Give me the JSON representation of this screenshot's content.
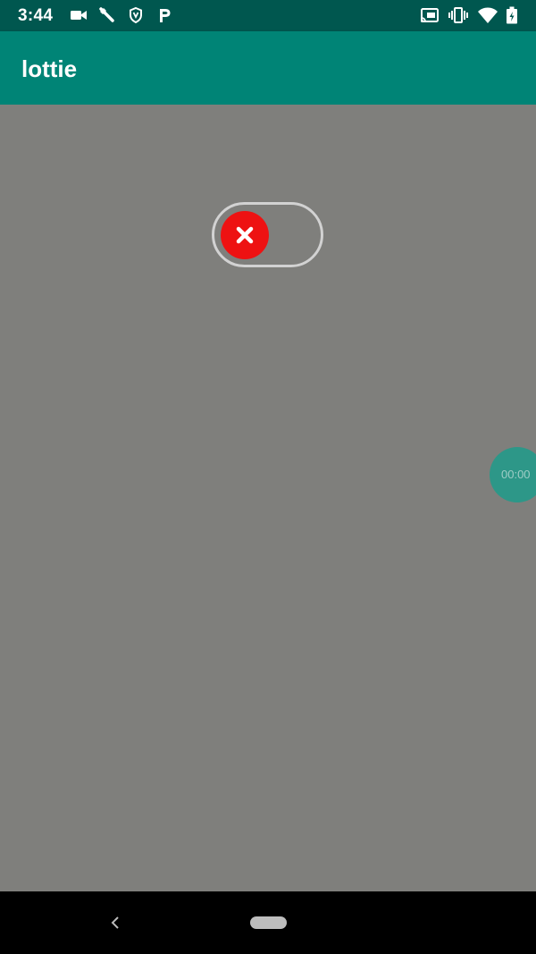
{
  "status_bar": {
    "time": "3:44",
    "left_icons": [
      "video-camera-icon",
      "wrench-icon",
      "shield-icon",
      "parking-p-icon"
    ],
    "right_icons": [
      "cast-icon",
      "vibrate-icon",
      "wifi-icon",
      "battery-icon"
    ],
    "background": "#00574f"
  },
  "app_bar": {
    "title": "lottie",
    "background": "#008476"
  },
  "content": {
    "background": "#7f7f7c",
    "toggle": {
      "state": "off",
      "knob_icon": "close-icon",
      "knob_color": "#ee1212",
      "track_color": "#d2d2d2"
    },
    "timer_bubble": {
      "text": "00:00",
      "color": "#2d9788"
    }
  },
  "nav_bar": {
    "back_icon": "back-chevron-icon",
    "home_icon": "home-pill-icon",
    "background": "#000000"
  }
}
